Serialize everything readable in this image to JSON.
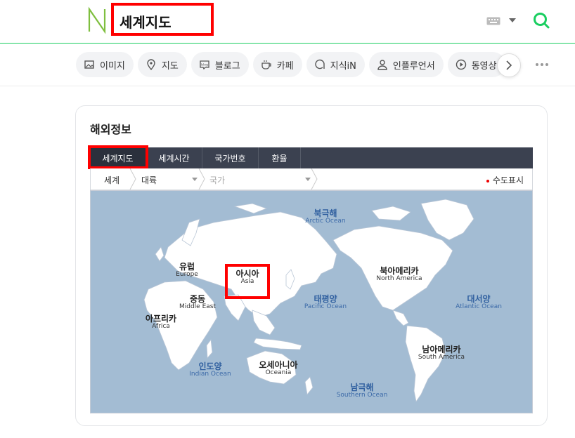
{
  "header": {
    "logo_alt": "N",
    "search_query": "세계지도",
    "colors": {
      "brand": "#19ce60"
    }
  },
  "tabs": [
    {
      "label": "이미지",
      "icon": "image-icon"
    },
    {
      "label": "지도",
      "icon": "map-pin-icon"
    },
    {
      "label": "블로그",
      "icon": "blog-icon"
    },
    {
      "label": "카페",
      "icon": "cafe-icon"
    },
    {
      "label": "지식iN",
      "icon": "kin-icon"
    },
    {
      "label": "인플루언서",
      "icon": "person-icon"
    },
    {
      "label": "동영상",
      "icon": "play-icon"
    }
  ],
  "card": {
    "title": "해외정보",
    "map_tabs": [
      "세계지도",
      "세계시간",
      "국가번호",
      "환율"
    ],
    "breadcrumb": {
      "world": "세계",
      "continent": "대륙",
      "country": "국가",
      "capital_toggle": "수도표시"
    },
    "continents": [
      {
        "ko": "유럽",
        "en": "Europe"
      },
      {
        "ko": "아시아",
        "en": "Asia"
      },
      {
        "ko": "중동",
        "en": "Middle East"
      },
      {
        "ko": "아프리카",
        "en": "Africa"
      },
      {
        "ko": "오세아니아",
        "en": "Oceania"
      },
      {
        "ko": "북아메리카",
        "en": "North America"
      },
      {
        "ko": "남아메리카",
        "en": "South America"
      }
    ],
    "oceans": [
      {
        "ko": "북극해",
        "en": "Arctic Ocean"
      },
      {
        "ko": "태평양",
        "en": "Pacific Ocean"
      },
      {
        "ko": "대서양",
        "en": "Atlantic Ocean"
      },
      {
        "ko": "인도양",
        "en": "Indian Ocean"
      },
      {
        "ko": "남극해",
        "en": "Southern Ocean"
      }
    ]
  }
}
